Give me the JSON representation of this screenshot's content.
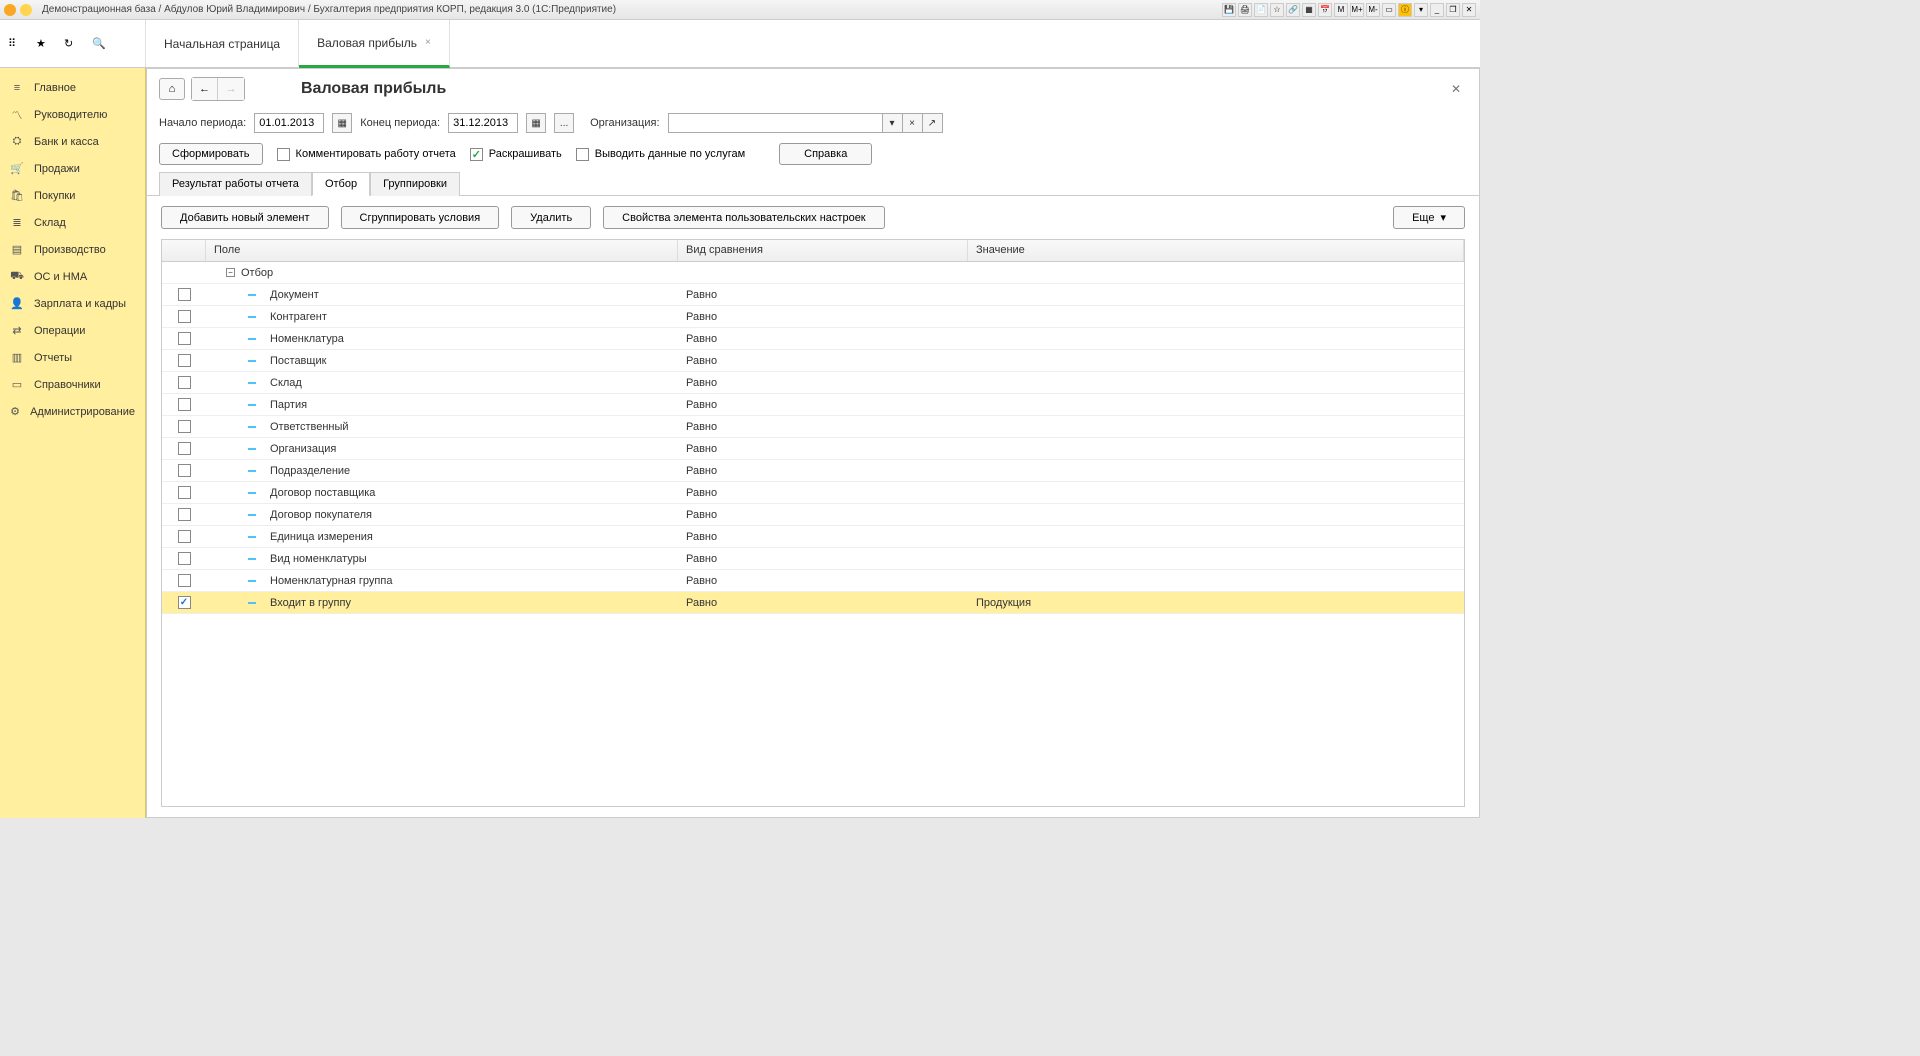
{
  "titlebar": {
    "text": "Демонстрационная база / Абдулов Юрий Владимирович / Бухгалтерия предприятия КОРП, редакция 3.0  (1С:Предприятие)",
    "right_buttons": [
      "M",
      "M+",
      "M-"
    ]
  },
  "tabs": [
    {
      "label": "Начальная страница",
      "active": false
    },
    {
      "label": "Валовая прибыль",
      "active": true
    }
  ],
  "sidebar": [
    {
      "label": "Главное",
      "icon": "menu"
    },
    {
      "label": "Руководителю",
      "icon": "chart"
    },
    {
      "label": "Банк и касса",
      "icon": "bank"
    },
    {
      "label": "Продажи",
      "icon": "cart"
    },
    {
      "label": "Покупки",
      "icon": "basket"
    },
    {
      "label": "Склад",
      "icon": "warehouse"
    },
    {
      "label": "Производство",
      "icon": "factory"
    },
    {
      "label": "ОС и НМА",
      "icon": "truck"
    },
    {
      "label": "Зарплата и кадры",
      "icon": "person"
    },
    {
      "label": "Операции",
      "icon": "ops"
    },
    {
      "label": "Отчеты",
      "icon": "bars"
    },
    {
      "label": "Справочники",
      "icon": "book"
    },
    {
      "label": "Администрирование",
      "icon": "gear"
    }
  ],
  "page": {
    "title": "Валовая прибыль",
    "period_start_label": "Начало периода:",
    "period_start": "01.01.2013",
    "period_end_label": "Конец периода:",
    "period_end": "31.12.2013",
    "org_label": "Организация:",
    "org_value": "",
    "ellipsis": "...",
    "btn_generate": "Сформировать",
    "opt_comment": "Комментировать работу отчета",
    "opt_colorize": "Раскрашивать",
    "opt_services": "Выводить данные по услугам",
    "btn_help": "Справка"
  },
  "subtabs": [
    {
      "label": "Результат работы отчета",
      "active": false
    },
    {
      "label": "Отбор",
      "active": true
    },
    {
      "label": "Группировки",
      "active": false
    }
  ],
  "toolbar": {
    "add": "Добавить новый элемент",
    "group": "Сгруппировать условия",
    "delete": "Удалить",
    "props": "Свойства элемента пользовательских настроек",
    "more": "Еще"
  },
  "grid": {
    "headers": {
      "field": "Поле",
      "comparison": "Вид сравнения",
      "value": "Значение"
    },
    "group_label": "Отбор",
    "rows": [
      {
        "checked": false,
        "field": "Документ",
        "comparison": "Равно",
        "value": ""
      },
      {
        "checked": false,
        "field": "Контрагент",
        "comparison": "Равно",
        "value": ""
      },
      {
        "checked": false,
        "field": "Номенклатура",
        "comparison": "Равно",
        "value": ""
      },
      {
        "checked": false,
        "field": "Поставщик",
        "comparison": "Равно",
        "value": ""
      },
      {
        "checked": false,
        "field": "Склад",
        "comparison": "Равно",
        "value": ""
      },
      {
        "checked": false,
        "field": "Партия",
        "comparison": "Равно",
        "value": ""
      },
      {
        "checked": false,
        "field": "Ответственный",
        "comparison": "Равно",
        "value": ""
      },
      {
        "checked": false,
        "field": "Организация",
        "comparison": "Равно",
        "value": ""
      },
      {
        "checked": false,
        "field": "Подразделение",
        "comparison": "Равно",
        "value": ""
      },
      {
        "checked": false,
        "field": "Договор поставщика",
        "comparison": "Равно",
        "value": ""
      },
      {
        "checked": false,
        "field": "Договор покупателя",
        "comparison": "Равно",
        "value": ""
      },
      {
        "checked": false,
        "field": "Единица измерения",
        "comparison": "Равно",
        "value": ""
      },
      {
        "checked": false,
        "field": "Вид номенклатуры",
        "comparison": "Равно",
        "value": ""
      },
      {
        "checked": false,
        "field": "Номенклатурная группа",
        "comparison": "Равно",
        "value": ""
      },
      {
        "checked": true,
        "field": "Входит в группу",
        "comparison": "Равно",
        "value": "Продукция",
        "selected": true
      }
    ]
  }
}
